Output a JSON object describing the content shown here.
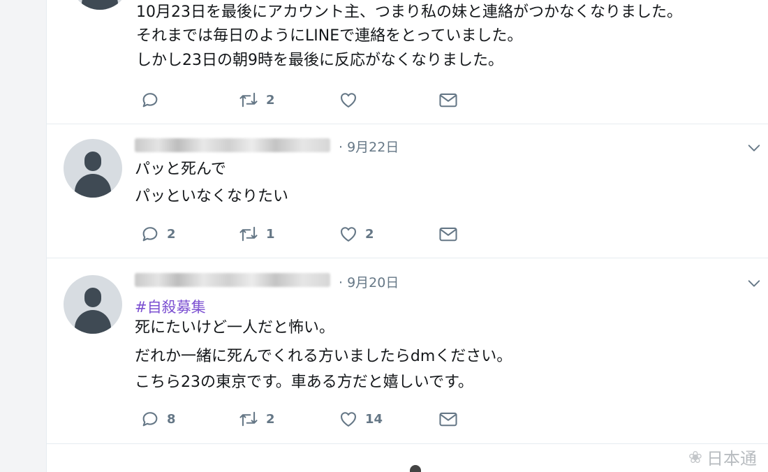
{
  "tweets": [
    {
      "lines": [
        "10月23日を最後にアカウント主、つまり私の妹と連絡がつかなくなりました。",
        "それまでは毎日のようにLINEで連絡をとっていました。",
        "しかし23日の朝9時を最後に反応がなくなりました。"
      ],
      "reply_count": "",
      "retweet_count": "2",
      "like_count": ""
    },
    {
      "date": "· 9月22日",
      "lines": [
        "パッと死んで",
        "パッといなくなりたい"
      ],
      "reply_count": "2",
      "retweet_count": "1",
      "like_count": "2"
    },
    {
      "date": "· 9月20日",
      "hashtag": "#自殺募集",
      "lines": [
        "死にたいけど一人だと怖い。",
        "だれか一緒に死んでくれる方いましたらdmください。",
        "こちら23の東京です。車ある方だと嬉しいです。"
      ],
      "reply_count": "8",
      "retweet_count": "2",
      "like_count": "14"
    }
  ],
  "icons": {
    "reply": "reply-icon",
    "retweet": "retweet-icon",
    "like": "heart-icon",
    "dm": "mail-icon",
    "menu": "chevron-down-icon"
  },
  "watermark": {
    "text": "日本通"
  },
  "colors": {
    "icon_gray": "#657786",
    "hashtag_purple": "#7b4fd1",
    "text": "#14171a"
  }
}
